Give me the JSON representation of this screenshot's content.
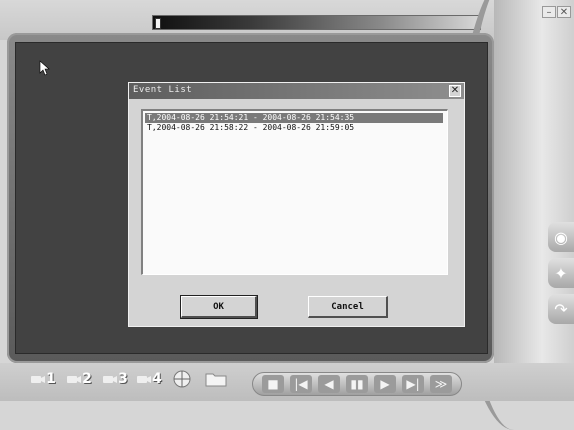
{
  "dialog": {
    "title": "Event List",
    "close_glyph": "✕",
    "events": [
      {
        "label": "T,2004-08-26 21:54:21 - 2004-08-26 21:54:35",
        "selected": true
      },
      {
        "label": "T,2004-08-26 21:58:22 - 2004-08-26 21:59:05",
        "selected": false
      }
    ],
    "ok_label": "OK",
    "cancel_label": "Cancel"
  },
  "bottom_toolbar": {
    "camera_buttons": [
      {
        "number": "1",
        "icon": "camera-icon"
      },
      {
        "number": "2",
        "icon": "camera-icon"
      },
      {
        "number": "3",
        "icon": "camera-icon"
      },
      {
        "number": "4",
        "icon": "camera-icon"
      }
    ],
    "quad_view_icon": "quad-view-icon",
    "folder_icon": "folder-icon"
  },
  "transport": {
    "buttons": [
      {
        "name": "stop-button",
        "glyph": "■",
        "icon": "stop-icon"
      },
      {
        "name": "previous-button",
        "glyph": "|◀",
        "icon": "skip-back-icon"
      },
      {
        "name": "rewind-button",
        "glyph": "◀",
        "icon": "rewind-icon"
      },
      {
        "name": "pause-button",
        "glyph": "▮▮",
        "icon": "pause-icon"
      },
      {
        "name": "play-button",
        "glyph": "▶",
        "icon": "play-icon"
      },
      {
        "name": "next-button",
        "glyph": "▶|",
        "icon": "skip-forward-icon"
      },
      {
        "name": "fast-forward-button",
        "glyph": "≫",
        "icon": "fast-forward-icon"
      }
    ]
  },
  "side_buttons": [
    {
      "name": "capture-button",
      "glyph": "◉",
      "icon": "camera-snapshot-icon"
    },
    {
      "name": "settings-button",
      "glyph": "✦",
      "icon": "tools-icon"
    },
    {
      "name": "export-button",
      "glyph": "↷",
      "icon": "arrow-curve-icon"
    }
  ],
  "window_controls": {
    "minimize": "–",
    "close": "✕"
  },
  "colors": {
    "screen_background": "#424242",
    "selection": "#7a7a7a",
    "dialog_background": "#d4d4d4"
  }
}
